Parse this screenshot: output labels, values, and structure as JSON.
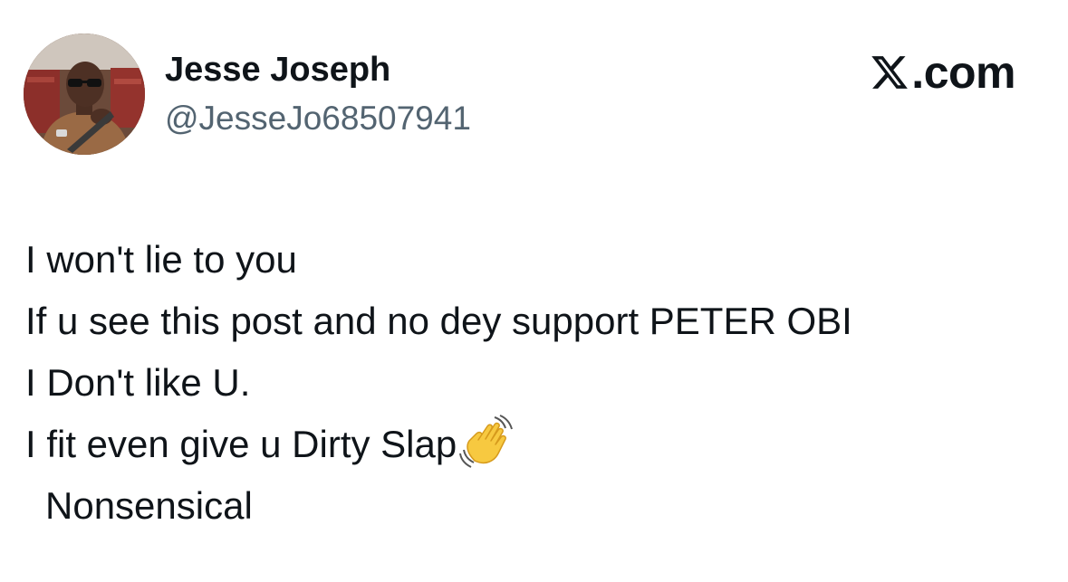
{
  "author": {
    "display_name": "Jesse Joseph",
    "handle": "@JesseJo68507941"
  },
  "brand": {
    "logo_icon": "x-logo-icon",
    "suffix": ".com"
  },
  "tweet": {
    "lines": [
      "I won't lie to you",
      "If u see this post and no dey support PETER OBI",
      "I Don't like U.",
      "I fit even give u Dirty Slap",
      "Nonsensical"
    ],
    "emoji": "waving-hand-emoji"
  },
  "colors": {
    "text": "#0f1419",
    "secondary_text": "#536471",
    "background": "#ffffff"
  }
}
